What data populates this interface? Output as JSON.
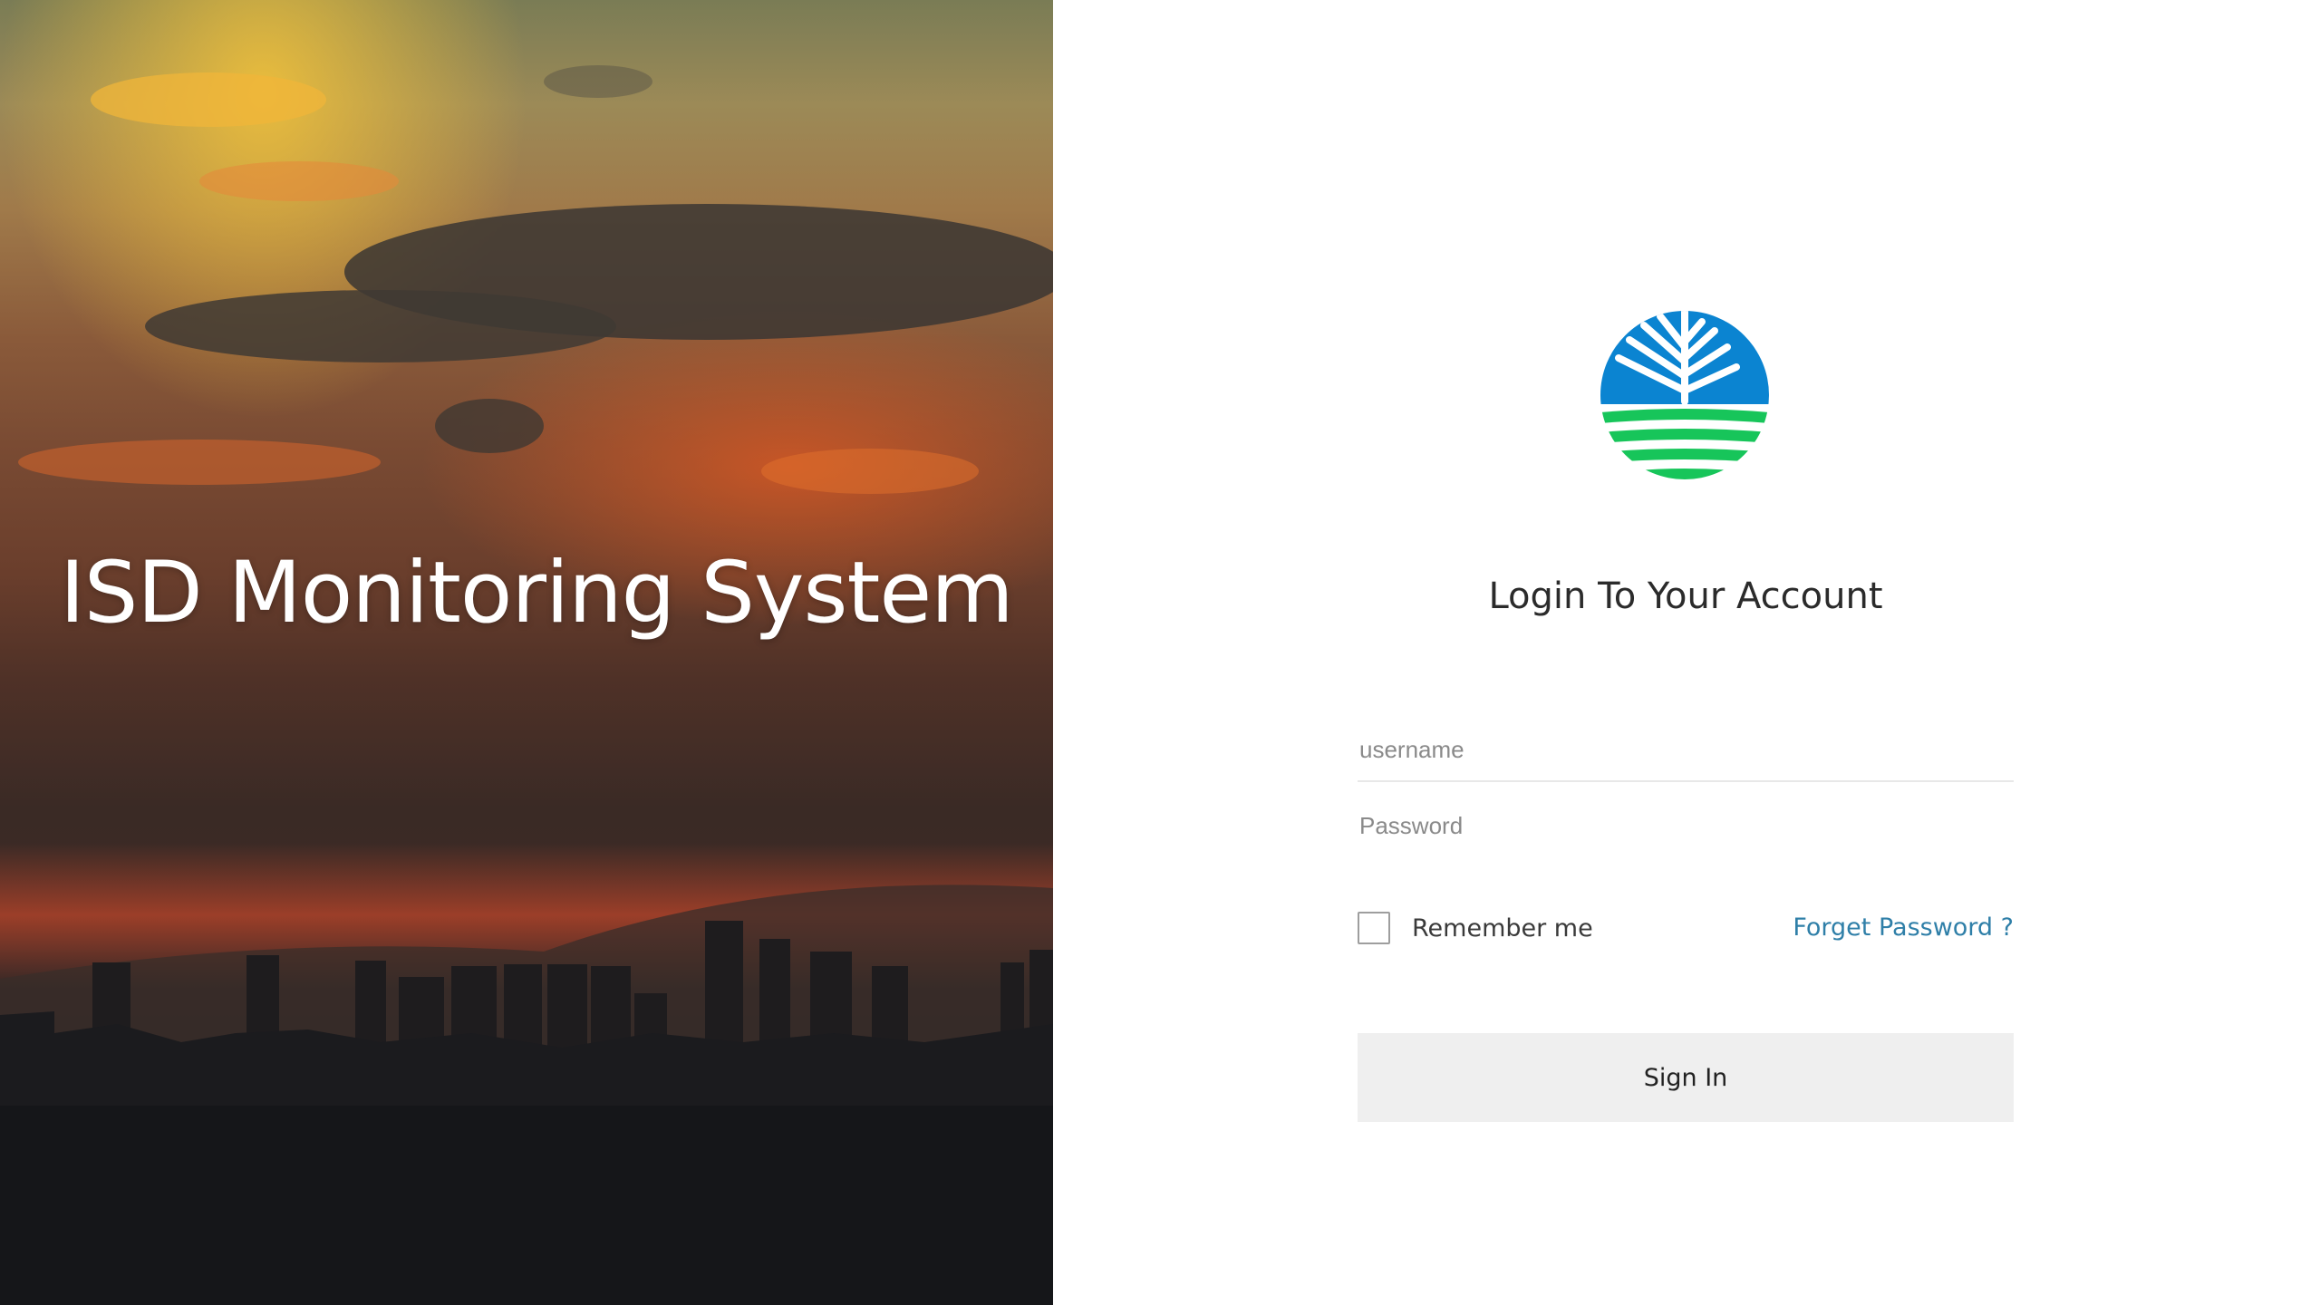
{
  "hero": {
    "title": "ISD Monitoring System",
    "image": "city-skyline-sunset-photo"
  },
  "logo": {
    "icon": "denr-leaf-water-logo",
    "colors": {
      "blue": "#0b84d1",
      "green": "#17c55a"
    }
  },
  "login": {
    "heading": "Login To Your Account",
    "username": {
      "value": "",
      "placeholder": "username"
    },
    "password": {
      "value": "",
      "placeholder": "Password"
    },
    "remember_label": "Remember me",
    "remember_checked": false,
    "forget_label": "Forget Password ?",
    "signin_label": "Sign In"
  },
  "colors": {
    "link": "#2f7fa8",
    "button_bg": "#efefef"
  }
}
